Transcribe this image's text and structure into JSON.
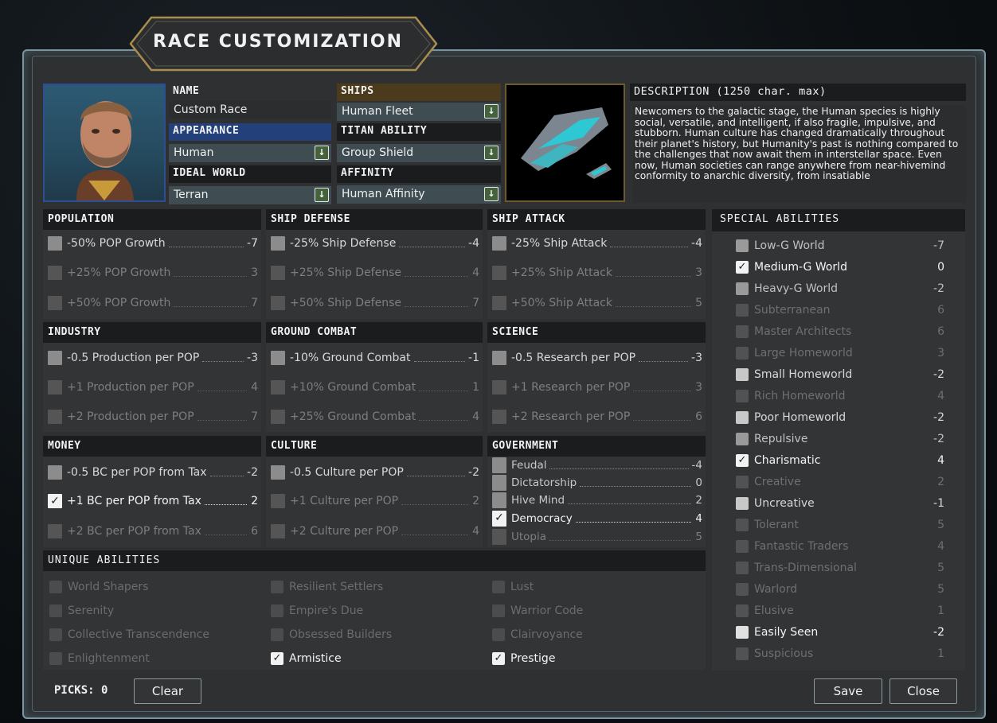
{
  "window": {
    "title": "RACE CUSTOMIZATION"
  },
  "header": {
    "name_label": "NAME",
    "name_value": "Custom Race",
    "appearance_label": "APPEARANCE",
    "appearance_value": "Human",
    "ideal_world_label": "IDEAL WORLD",
    "ideal_world_value": "Terran",
    "ships_label": "SHIPS",
    "ships_value": "Human Fleet",
    "titan_label": "TITAN ABILITY",
    "titan_value": "Group Shield",
    "affinity_label": "AFFINITY",
    "affinity_value": "Human Affinity",
    "description_label": "DESCRIPTION (1250 char. max)",
    "description_text": "Newcomers to the galactic stage, the Human species is highly social, versatile, and intelligent, if also fragile, impulsive, and stubborn. Human culture has changed dramatically throughout their planet's history, but Humanity's past is nothing compared to the challenges that now await them in interstellar space. Even now, Human societies can range anywhere from near-hivemind conformity to anarchic diversity, from insatiable"
  },
  "categories": {
    "population": {
      "title": "POPULATION",
      "items": [
        {
          "label": "-50% POP Growth",
          "value": "-7"
        },
        {
          "label": "+25% POP Growth",
          "value": "3"
        },
        {
          "label": "+50% POP Growth",
          "value": "7"
        }
      ]
    },
    "ship_defense": {
      "title": "SHIP DEFENSE",
      "items": [
        {
          "label": "-25% Ship Defense",
          "value": "-4"
        },
        {
          "label": "+25% Ship Defense",
          "value": "4"
        },
        {
          "label": "+50% Ship Defense",
          "value": "7"
        }
      ]
    },
    "ship_attack": {
      "title": "SHIP ATTACK",
      "items": [
        {
          "label": "-25% Ship Attack",
          "value": "-4"
        },
        {
          "label": "+25% Ship Attack",
          "value": "3"
        },
        {
          "label": "+50% Ship Attack",
          "value": "5"
        }
      ]
    },
    "industry": {
      "title": "INDUSTRY",
      "items": [
        {
          "label": "-0.5 Production per POP",
          "value": "-3"
        },
        {
          "label": "+1 Production per POP",
          "value": "4"
        },
        {
          "label": "+2 Production per POP",
          "value": "7"
        }
      ]
    },
    "ground_combat": {
      "title": "GROUND COMBAT",
      "items": [
        {
          "label": "-10% Ground Combat",
          "value": "-1"
        },
        {
          "label": "+10% Ground Combat",
          "value": "1"
        },
        {
          "label": "+25% Ground Combat",
          "value": "4"
        }
      ]
    },
    "science": {
      "title": "SCIENCE",
      "items": [
        {
          "label": "-0.5 Research per POP",
          "value": "-3"
        },
        {
          "label": "+1 Research per POP",
          "value": "3"
        },
        {
          "label": "+2 Research per POP",
          "value": "6"
        }
      ]
    },
    "money": {
      "title": "MONEY",
      "items": [
        {
          "label": "-0.5 BC per POP from Tax",
          "value": "-2"
        },
        {
          "label": "+1 BC per POP from Tax",
          "value": "2"
        },
        {
          "label": "+2 BC per POP from Tax",
          "value": "6"
        }
      ]
    },
    "culture": {
      "title": "CULTURE",
      "items": [
        {
          "label": "-0.5 Culture per POP",
          "value": "-2"
        },
        {
          "label": "+1 Culture per POP",
          "value": "2"
        },
        {
          "label": "+2 Culture per POP",
          "value": "4"
        }
      ]
    },
    "government": {
      "title": "GOVERNMENT",
      "items": [
        {
          "label": "Feudal",
          "value": "-4"
        },
        {
          "label": "Dictatorship",
          "value": "0"
        },
        {
          "label": "Hive Mind",
          "value": "2"
        },
        {
          "label": "Democracy",
          "value": "4"
        },
        {
          "label": "Utopia",
          "value": "5"
        }
      ]
    }
  },
  "unique": {
    "title": "UNIQUE ABILITIES",
    "items": [
      "World Shapers",
      "Serenity",
      "Collective Transcendence",
      "Enlightenment",
      "Resilient Settlers",
      "Empire's Due",
      "Obsessed Builders",
      "Armistice",
      "Lust",
      "Warrior Code",
      "Clairvoyance",
      "Prestige"
    ]
  },
  "special": {
    "title": "SPECIAL ABILITIES",
    "items": [
      {
        "label": "Low-G World",
        "value": "-7"
      },
      {
        "label": "Medium-G World",
        "value": "0"
      },
      {
        "label": "Heavy-G World",
        "value": "-2"
      },
      {
        "label": "Subterranean",
        "value": "6"
      },
      {
        "label": "Master Architects",
        "value": "6"
      },
      {
        "label": "Large Homeworld",
        "value": "3"
      },
      {
        "label": "Small Homeworld",
        "value": "-2"
      },
      {
        "label": "Rich Homeworld",
        "value": "4"
      },
      {
        "label": "Poor Homeworld",
        "value": "-2"
      },
      {
        "label": "Repulsive",
        "value": "-2"
      },
      {
        "label": "Charismatic",
        "value": "4"
      },
      {
        "label": "Creative",
        "value": "2"
      },
      {
        "label": "Uncreative",
        "value": "-1"
      },
      {
        "label": "Tolerant",
        "value": "5"
      },
      {
        "label": "Fantastic Traders",
        "value": "4"
      },
      {
        "label": "Trans-Dimensional",
        "value": "5"
      },
      {
        "label": "Warlord",
        "value": "5"
      },
      {
        "label": "Elusive",
        "value": "1"
      },
      {
        "label": "Easily Seen",
        "value": "-2"
      },
      {
        "label": "Suspicious",
        "value": "1"
      }
    ]
  },
  "footer": {
    "picks_label": "PICKS: 0",
    "clear_label": "Clear",
    "save_label": "Save",
    "close_label": "Close"
  },
  "colors": {
    "accent": "#23407a",
    "ships_header": "#4b3b1c",
    "checkbox_on": "#f2f2f2",
    "dropdown": "#44633c"
  }
}
